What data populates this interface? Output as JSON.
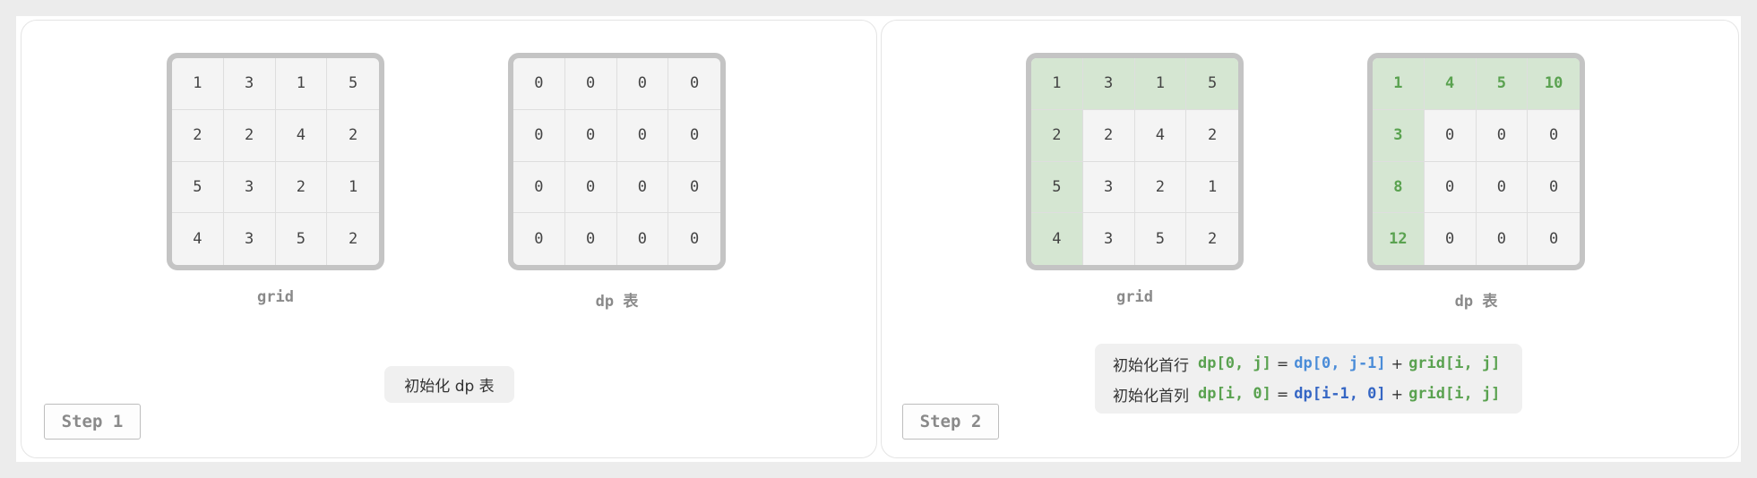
{
  "step1": {
    "grid_label": "grid",
    "dp_label": "dp 表",
    "grid": [
      [
        1,
        3,
        1,
        5
      ],
      [
        2,
        2,
        4,
        2
      ],
      [
        5,
        3,
        2,
        1
      ],
      [
        4,
        3,
        5,
        2
      ]
    ],
    "dp": [
      [
        0,
        0,
        0,
        0
      ],
      [
        0,
        0,
        0,
        0
      ],
      [
        0,
        0,
        0,
        0
      ],
      [
        0,
        0,
        0,
        0
      ]
    ],
    "note": "初始化 dp 表",
    "step_label": "Step 1"
  },
  "step2": {
    "grid_label": "grid",
    "dp_label": "dp 表",
    "grid": [
      [
        1,
        3,
        1,
        5
      ],
      [
        2,
        2,
        4,
        2
      ],
      [
        5,
        3,
        2,
        1
      ],
      [
        4,
        3,
        5,
        2
      ]
    ],
    "dp": [
      [
        1,
        4,
        5,
        10
      ],
      [
        3,
        0,
        0,
        0
      ],
      [
        8,
        0,
        0,
        0
      ],
      [
        12,
        0,
        0,
        0
      ]
    ],
    "formula_row": {
      "label": "初始化首行",
      "lhs": "dp[0, j]",
      "eq": "=",
      "term1": "dp[0, j-1]",
      "plus": "+",
      "term2": "grid[i, j]"
    },
    "formula_col": {
      "label": "初始化首列",
      "lhs": "dp[i, 0]",
      "eq": "=",
      "term1": "dp[i-1, 0]",
      "plus": "+",
      "term2": "grid[i, j]"
    },
    "step_label": "Step 2"
  },
  "colors": {
    "highlight": "#d5e6d2",
    "dp_value": "#5aa250",
    "term_blue_light": "#4a8cd8",
    "term_blue_dark": "#3566c4",
    "grid_border": "#c4c4c4"
  }
}
